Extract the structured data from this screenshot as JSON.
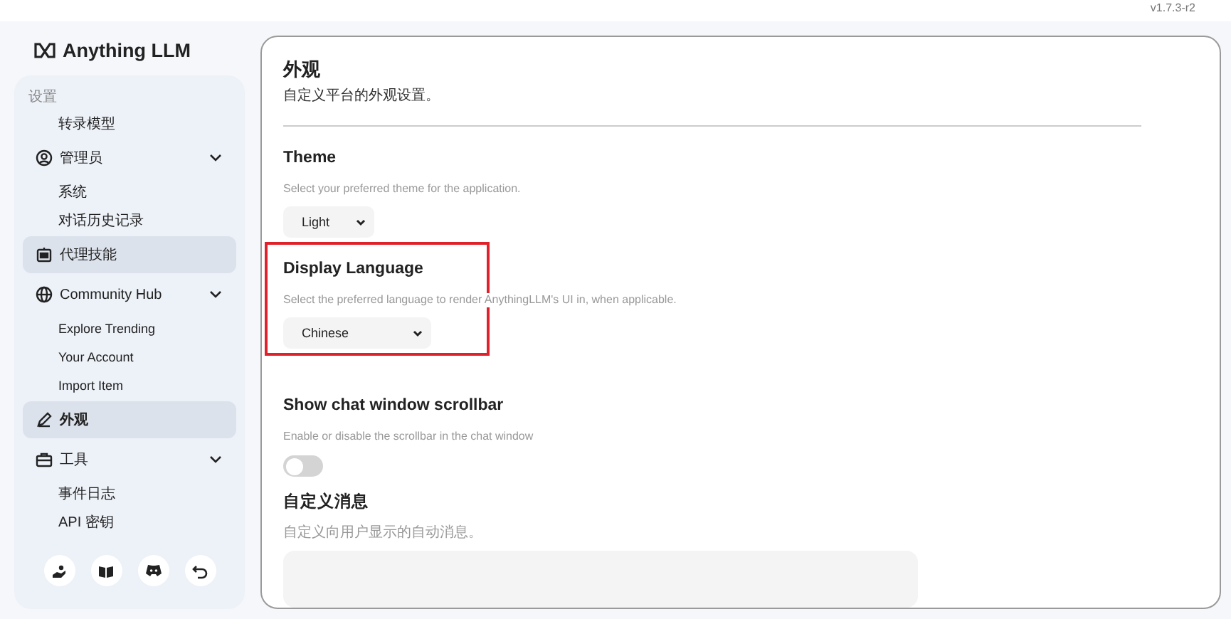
{
  "version": "v1.7.3-r2",
  "logo": {
    "text": "Anything LLM"
  },
  "sidebar": {
    "items": [
      {
        "kind": "label",
        "label": "设置"
      },
      {
        "kind": "link",
        "label": "转录模型"
      },
      {
        "kind": "group",
        "label": "管理员",
        "expanded": true,
        "selected": false,
        "highlighted": false,
        "children": [
          {
            "label": "系统"
          },
          {
            "label": "对话历史记录"
          }
        ]
      },
      {
        "kind": "page",
        "label": "代理技能",
        "selected": false,
        "highlighted": true
      },
      {
        "kind": "group",
        "label": "Community Hub",
        "expanded": true,
        "selected": false,
        "highlighted": false,
        "children": [
          {
            "label": "Explore Trending"
          },
          {
            "label": "Your Account"
          },
          {
            "label": "Import Item"
          }
        ]
      },
      {
        "kind": "page",
        "label": "外观",
        "selected": true,
        "highlighted": true
      },
      {
        "kind": "group",
        "label": "工具",
        "expanded": true,
        "selected": false,
        "highlighted": false,
        "children": [
          {
            "label": "事件日志"
          },
          {
            "label": "API 密钥"
          }
        ]
      }
    ]
  },
  "page": {
    "title": "外观",
    "subtitle": "自定义平台的外观设置。",
    "sections": [
      {
        "kind": "select",
        "title": "Theme",
        "description": "Select your preferred theme for the application.",
        "value": "Light",
        "highlighted": false
      },
      {
        "kind": "select",
        "title": "Display Language",
        "description": "Select the preferred language to render AnythingLLM's UI in, when applicable.",
        "value": "Chinese",
        "highlighted": true
      },
      {
        "kind": "toggle",
        "title": "Show chat window scrollbar",
        "description": "Enable or disable the scrollbar in the chat window",
        "on": false,
        "highlighted": false
      },
      {
        "kind": "textarea",
        "title": "自定义消息",
        "description": "自定义向用户显示的自动消息。",
        "highlighted": false
      }
    ]
  }
}
